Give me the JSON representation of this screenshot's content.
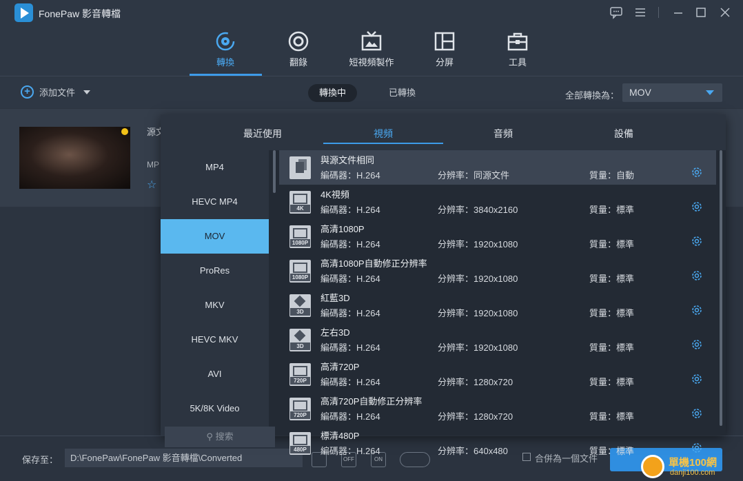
{
  "app": {
    "title": "FonePaw 影音轉檔"
  },
  "nav": {
    "tabs": [
      {
        "label": "轉換",
        "icon": "convert-icon",
        "active": true
      },
      {
        "label": "翻錄",
        "icon": "disc-icon",
        "active": false
      },
      {
        "label": "短視頻製作",
        "icon": "tv-icon",
        "active": false
      },
      {
        "label": "分屏",
        "icon": "split-screen-icon",
        "active": false
      },
      {
        "label": "工具",
        "icon": "toolbox-icon",
        "active": false
      }
    ]
  },
  "toolbar": {
    "add_file": "添加文件",
    "seg_converting": "轉換中",
    "seg_converted": "已轉換",
    "convert_all_label": "全部轉換為：",
    "convert_all_value": "MOV"
  },
  "file": {
    "source_label": "源文",
    "format_label": "MP"
  },
  "panel": {
    "tabs": [
      "最近使用",
      "視頻",
      "音頻",
      "設備"
    ],
    "active_tab": "視頻",
    "formats": [
      "MP4",
      "HEVC MP4",
      "MOV",
      "ProRes",
      "MKV",
      "HEVC MKV",
      "AVI",
      "5K/8K Video"
    ],
    "active_format": "MOV",
    "search_placeholder": "搜索",
    "presets": [
      {
        "name": "與源文件相同",
        "codec": "編碼器：H.264",
        "resolution": "分辨率：同源文件",
        "quality": "質量：自動",
        "icon": "same-as-source-icon",
        "badge": ""
      },
      {
        "name": "4K視頻",
        "codec": "編碼器：H.264",
        "resolution": "分辨率：3840x2160",
        "quality": "質量：標準",
        "icon": "film-icon",
        "badge": "4K"
      },
      {
        "name": "高清1080P",
        "codec": "編碼器：H.264",
        "resolution": "分辨率：1920x1080",
        "quality": "質量：標準",
        "icon": "film-icon",
        "badge": "1080P"
      },
      {
        "name": "高清1080P自動修正分辨率",
        "codec": "編碼器：H.264",
        "resolution": "分辨率：1920x1080",
        "quality": "質量：標準",
        "icon": "film-icon",
        "badge": "1080P"
      },
      {
        "name": "紅藍3D",
        "codec": "編碼器：H.264",
        "resolution": "分辨率：1920x1080",
        "quality": "質量：標準",
        "icon": "cube-icon",
        "badge": "3D"
      },
      {
        "name": "左右3D",
        "codec": "編碼器：H.264",
        "resolution": "分辨率：1920x1080",
        "quality": "質量：標準",
        "icon": "cube-icon",
        "badge": "3D"
      },
      {
        "name": "高清720P",
        "codec": "編碼器：H.264",
        "resolution": "分辨率：1280x720",
        "quality": "質量：標準",
        "icon": "film-icon",
        "badge": "720P"
      },
      {
        "name": "高清720P自動修正分辨率",
        "codec": "編碼器：H.264",
        "resolution": "分辨率：1280x720",
        "quality": "質量：標準",
        "icon": "film-icon",
        "badge": "720P"
      },
      {
        "name": "標清480P",
        "codec": "編碼器：H.264",
        "resolution": "分辨率：640x480",
        "quality": "質量：標準",
        "icon": "film-icon",
        "badge": "480P"
      }
    ]
  },
  "bottom": {
    "save_label": "保存至：",
    "save_path": "D:\\FonePaw\\FonePaw 影音轉檔\\Converted",
    "merge_label": "合併為一個文件",
    "off_badge": "OFF",
    "on_badge": "ON"
  },
  "watermark": {
    "line1": "單機100網",
    "line2": "danji100.com"
  },
  "colors": {
    "accent": "#3d9be9",
    "selected_format": "#5ab8ef",
    "background": "#2c3440"
  }
}
